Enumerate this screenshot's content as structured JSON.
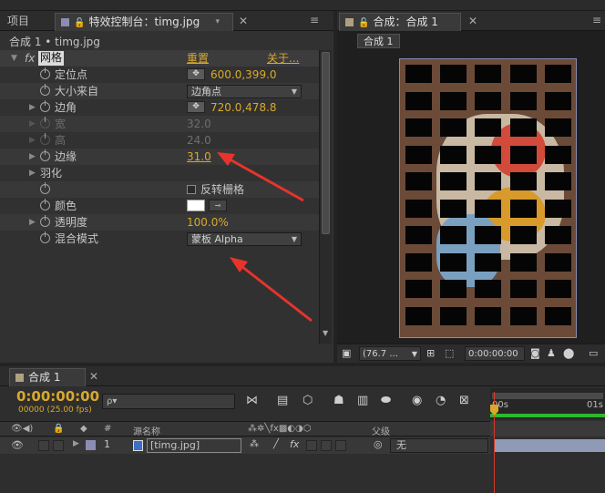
{
  "left_tabs": {
    "project": "项目",
    "effects": "特效控制台：timg.jpg",
    "menu_icon": "≡"
  },
  "breadcrumb": "合成 1 • timg.jpg",
  "effect": {
    "fx_label": "fx",
    "name": "网格",
    "reset": "重置",
    "about": "关于..."
  },
  "properties": [
    {
      "label": "定位点",
      "value": "600.0,399.0"
    },
    {
      "label": "大小来自",
      "value": "边角点"
    },
    {
      "label": "边角",
      "value": "720.0,478.8"
    },
    {
      "label": "宽",
      "value": "32.0"
    },
    {
      "label": "高",
      "value": "24.0"
    },
    {
      "label": "边缘",
      "value": "31.0"
    },
    {
      "label": "羽化",
      "value": ""
    },
    {
      "label": "",
      "value": "反转栅格"
    },
    {
      "label": "颜色",
      "value": ""
    },
    {
      "label": "透明度",
      "value": "100.0%"
    },
    {
      "label": "混合模式",
      "value": "蒙板 Alpha"
    }
  ],
  "viewer": {
    "tab": "合成：合成 1",
    "menu_icon": "≡",
    "sub_tab": "合成 1",
    "zoom": "(76.7 ...",
    "time": "0:00:00:00"
  },
  "timeline": {
    "tab": "合成 1",
    "menu_icon": "≡",
    "timecode": "0:00:00:00",
    "frames": "00000 (25.00 fps)",
    "search_placeholder": "ρ▾",
    "ruler": {
      "start": "00s",
      "mark": "01s"
    },
    "columns": {
      "hash": "#",
      "source": "源名称",
      "switches": "父级"
    },
    "layer": {
      "number": "1",
      "name": "[timg.jpg]",
      "parent": "无"
    }
  },
  "colors": {
    "accent": "#d9a92b",
    "arrow": "#e8332c",
    "grid_fill": "#000000",
    "swatch_comp": "#8c8cb4"
  },
  "grid": {
    "cols": 6,
    "rows": 10,
    "col_pitch": 38.2,
    "row_pitch": 29.5
  }
}
